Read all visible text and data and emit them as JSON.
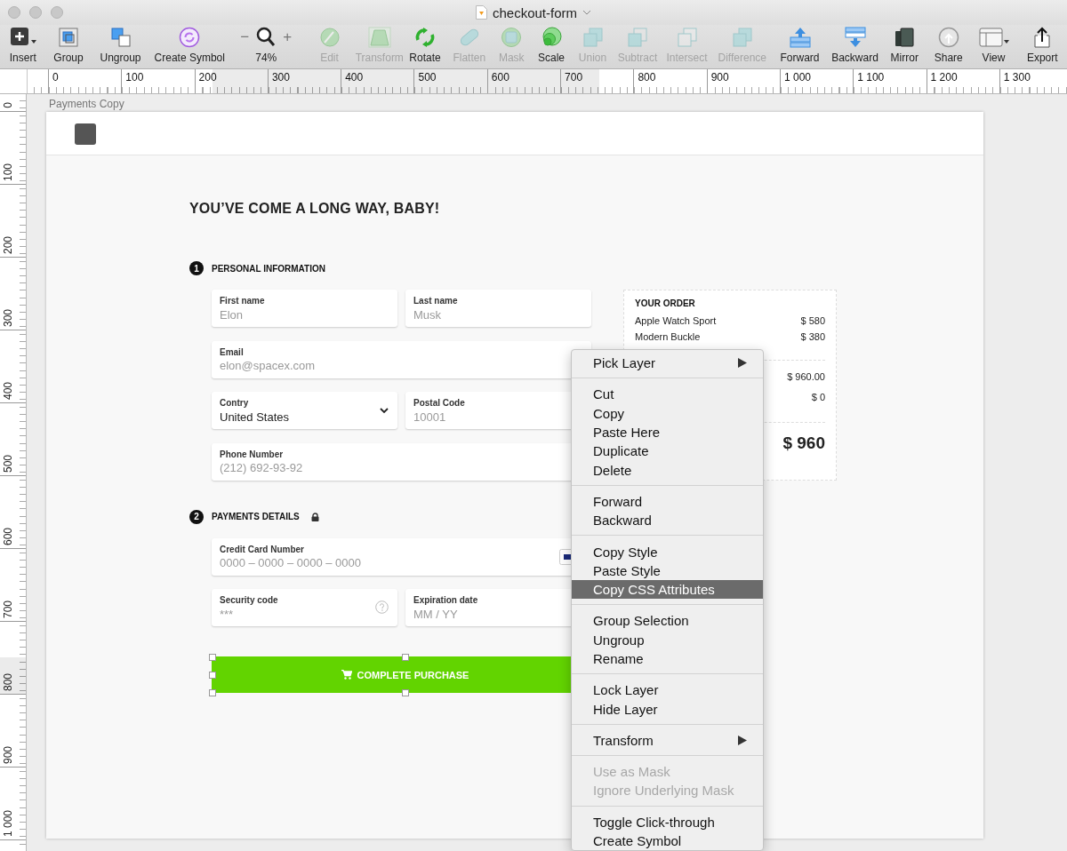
{
  "window": {
    "title": "checkout-form"
  },
  "toolbar": [
    {
      "kind": "insert",
      "label": "Insert",
      "disabled": false
    },
    {
      "kind": "group",
      "label": "Group",
      "disabled": false
    },
    {
      "kind": "ungroup",
      "label": "Ungroup",
      "disabled": false
    },
    {
      "kind": "symbol",
      "label": "Create Symbol",
      "disabled": false
    },
    {
      "kind": "zoom",
      "minus": "−",
      "plus": "+",
      "label": "74%"
    },
    {
      "kind": "edit",
      "label": "Edit",
      "disabled": true
    },
    {
      "kind": "transform",
      "label": "Transform",
      "disabled": true
    },
    {
      "kind": "rotate",
      "label": "Rotate",
      "disabled": false
    },
    {
      "kind": "flatten",
      "label": "Flatten",
      "disabled": true
    },
    {
      "kind": "mask",
      "label": "Mask",
      "disabled": true
    },
    {
      "kind": "scale",
      "label": "Scale",
      "disabled": false
    },
    {
      "kind": "union",
      "label": "Union",
      "disabled": true
    },
    {
      "kind": "subtract",
      "label": "Subtract",
      "disabled": true
    },
    {
      "kind": "intersect",
      "label": "Intersect",
      "disabled": true
    },
    {
      "kind": "difference",
      "label": "Difference",
      "disabled": true
    },
    {
      "kind": "forward",
      "label": "Forward",
      "disabled": false
    },
    {
      "kind": "backward",
      "label": "Backward",
      "disabled": false
    },
    {
      "kind": "mirror",
      "label": "Mirror",
      "disabled": false
    },
    {
      "kind": "share",
      "label": "Share",
      "disabled": false
    },
    {
      "kind": "view",
      "label": "View",
      "disabled": false
    },
    {
      "kind": "export",
      "label": "Export",
      "disabled": false
    }
  ],
  "rulers": {
    "horizontal": [
      "0",
      "100",
      "200",
      "300",
      "400",
      "500",
      "600",
      "700",
      "800",
      "900",
      "1 000",
      "1 100",
      "1 200",
      "1 300"
    ],
    "vertical": [
      "0",
      "100",
      "200",
      "300",
      "400",
      "500",
      "600",
      "700",
      "800",
      "900",
      "1 000"
    ]
  },
  "artboard": {
    "name": "Payments Copy",
    "heading": "YOU’VE COME A LONG WAY, BABY!",
    "sections": [
      {
        "number": "1",
        "title": "PERSONAL INFORMATION",
        "locked": false,
        "rows": [
          [
            {
              "kind": "text",
              "label": "First name",
              "placeholder": "Elon"
            },
            {
              "kind": "text",
              "label": "Last name",
              "placeholder": "Musk"
            }
          ],
          [
            {
              "kind": "text",
              "label": "Email",
              "placeholder": "elon@spacex.com"
            }
          ],
          [
            {
              "kind": "select",
              "label": "Contry",
              "value": "United States"
            },
            {
              "kind": "text",
              "label": "Postal Code",
              "placeholder": "10001"
            }
          ],
          [
            {
              "kind": "text",
              "label": "Phone Number",
              "placeholder": "(212) 692-93-92"
            }
          ]
        ]
      },
      {
        "number": "2",
        "title": "PAYMENTS DETAILS",
        "locked": true,
        "rows": [
          [
            {
              "kind": "card",
              "label": "Credit Card Number",
              "placeholder": "0000 – 0000 – 0000 – 0000"
            }
          ],
          [
            {
              "kind": "help",
              "label": "Security code",
              "placeholder": "***"
            },
            {
              "kind": "text",
              "label": "Expiration date",
              "placeholder": "MM / YY"
            }
          ]
        ]
      }
    ],
    "purchase_button": {
      "label": "COMPLETE PURCHASE",
      "selected": true
    },
    "order": {
      "title": "YOUR ORDER",
      "items": [
        {
          "name": "Apple Watch Sport",
          "price": "$ 580"
        },
        {
          "name": "Modern Buckle",
          "price": "$ 380"
        }
      ],
      "summary": [
        "$ 960.00",
        "$ 0"
      ],
      "total": "$ 960"
    }
  },
  "context_menu": {
    "groups": [
      [
        {
          "label": "Pick Layer",
          "submenu": true,
          "disabled": false,
          "selected": false
        }
      ],
      [
        {
          "label": "Cut",
          "submenu": false,
          "disabled": false,
          "selected": false
        },
        {
          "label": "Copy",
          "submenu": false,
          "disabled": false,
          "selected": false
        },
        {
          "label": "Paste Here",
          "submenu": false,
          "disabled": false,
          "selected": false
        },
        {
          "label": "Duplicate",
          "submenu": false,
          "disabled": false,
          "selected": false
        },
        {
          "label": "Delete",
          "submenu": false,
          "disabled": false,
          "selected": false
        }
      ],
      [
        {
          "label": "Forward",
          "submenu": false,
          "disabled": false,
          "selected": false
        },
        {
          "label": "Backward",
          "submenu": false,
          "disabled": false,
          "selected": false
        }
      ],
      [
        {
          "label": "Copy Style",
          "submenu": false,
          "disabled": false,
          "selected": false
        },
        {
          "label": "Paste Style",
          "submenu": false,
          "disabled": false,
          "selected": false
        },
        {
          "label": "Copy CSS Attributes",
          "submenu": false,
          "disabled": false,
          "selected": true
        }
      ],
      [
        {
          "label": "Group Selection",
          "submenu": false,
          "disabled": false,
          "selected": false
        },
        {
          "label": "Ungroup",
          "submenu": false,
          "disabled": false,
          "selected": false
        },
        {
          "label": "Rename",
          "submenu": false,
          "disabled": false,
          "selected": false
        }
      ],
      [
        {
          "label": "Lock Layer",
          "submenu": false,
          "disabled": false,
          "selected": false
        },
        {
          "label": "Hide Layer",
          "submenu": false,
          "disabled": false,
          "selected": false
        }
      ],
      [
        {
          "label": "Transform",
          "submenu": true,
          "disabled": false,
          "selected": false
        }
      ],
      [
        {
          "label": "Use as Mask",
          "submenu": false,
          "disabled": true,
          "selected": false
        },
        {
          "label": "Ignore Underlying Mask",
          "submenu": false,
          "disabled": true,
          "selected": false
        }
      ],
      [
        {
          "label": "Toggle Click-through",
          "submenu": false,
          "disabled": false,
          "selected": false
        },
        {
          "label": "Create Symbol",
          "submenu": false,
          "disabled": false,
          "selected": false
        }
      ]
    ]
  }
}
